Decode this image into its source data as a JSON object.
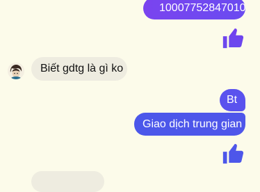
{
  "colors": {
    "background": "#fcfbea",
    "outgoing_gradient_start": "#7a44ef",
    "outgoing_gradient_end": "#4f56ea",
    "incoming_bubble": "#eeece0",
    "like_upper": "#7240ee",
    "like_lower": "#4c57ea"
  },
  "messages": [
    {
      "direction": "outgoing",
      "text": "10007752847010"
    },
    {
      "direction": "outgoing",
      "icon": "thumbs-up-icon"
    },
    {
      "direction": "incoming",
      "text": "Biết gdtg là gì ko",
      "avatar": "avatar-icon"
    },
    {
      "direction": "outgoing",
      "text": "Bt"
    },
    {
      "direction": "outgoing",
      "text": "Giao dịch trung gian"
    },
    {
      "direction": "outgoing",
      "icon": "thumbs-up-icon"
    },
    {
      "direction": "incoming",
      "text": ""
    }
  ]
}
